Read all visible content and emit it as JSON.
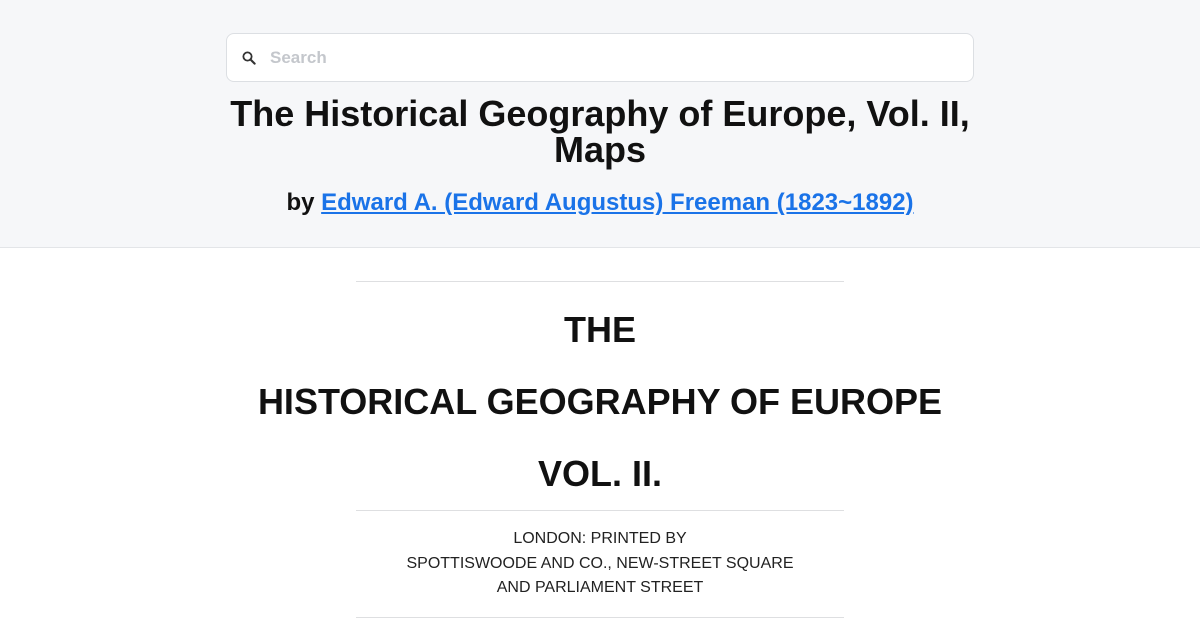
{
  "search": {
    "placeholder": "Search",
    "value": ""
  },
  "book": {
    "title": "The Historical Geography of Europe, Vol. II, Maps",
    "by_prefix": "by",
    "author": "Edward A. (Edward Augustus) Freeman (1823~1892)"
  },
  "cover": {
    "line1": "THE",
    "line2": "HISTORICAL GEOGRAPHY OF EUROPE",
    "line3": "VOL. II."
  },
  "imprint": {
    "line1": "LONDON: PRINTED BY",
    "line2": "SPOTTISWOODE AND CO., NEW-STREET SQUARE",
    "line3": "AND PARLIAMENT STREET"
  },
  "colors": {
    "header_bg": "#f6f7f9",
    "link": "#1a73e8",
    "text": "#111111"
  }
}
